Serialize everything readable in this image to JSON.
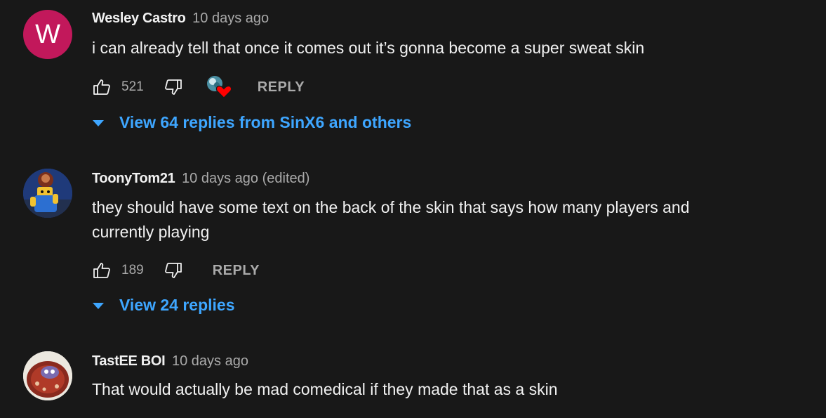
{
  "comments": [
    {
      "avatar_letter": "W",
      "author": "Wesley Castro",
      "time": "10 days ago",
      "text": "i can already tell that once it comes out it’s gonna become a super sweat skin",
      "likes": "521",
      "reply_label": "REPLY",
      "hearted_by_creator": true,
      "view_replies": "View 64 replies from SinX6 and others"
    },
    {
      "author": "ToonyTom21",
      "time": "10 days ago (edited)",
      "text": "they should have some text on the back of the skin that says how many players and currently playing",
      "likes": "189",
      "reply_label": "REPLY",
      "hearted_by_creator": false,
      "view_replies": "View 24 replies"
    },
    {
      "author": "TastEE BOI",
      "time": "10 days ago",
      "text": "That would actually be mad comedical if they made that as a skin"
    }
  ],
  "colors": {
    "background": "#181818",
    "link": "#3ea6ff",
    "muted": "#aaaaaa",
    "avatar_w": "#c2185b",
    "heart": "#ff0000"
  }
}
